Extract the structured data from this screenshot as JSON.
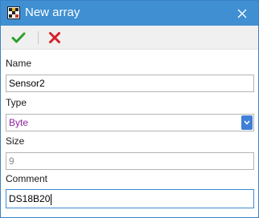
{
  "window": {
    "title": "New array",
    "icon": "array-grid-icon",
    "close_icon": "close-icon"
  },
  "toolbar": {
    "ok_icon": "checkmark-icon",
    "cancel_icon": "cross-icon"
  },
  "form": {
    "name": {
      "label": "Name",
      "value": "Sensor2"
    },
    "type": {
      "label": "Type",
      "value": "Byte"
    },
    "size": {
      "label": "Size",
      "value": "9"
    },
    "comment": {
      "label": "Comment",
      "value": "DS18B20"
    }
  },
  "colors": {
    "titlebar": "#3f8fd2",
    "ok_green": "#2e9e2e",
    "cancel_red": "#d42027",
    "select_text": "#8e1fa4",
    "focus_border": "#3b8ad6"
  }
}
